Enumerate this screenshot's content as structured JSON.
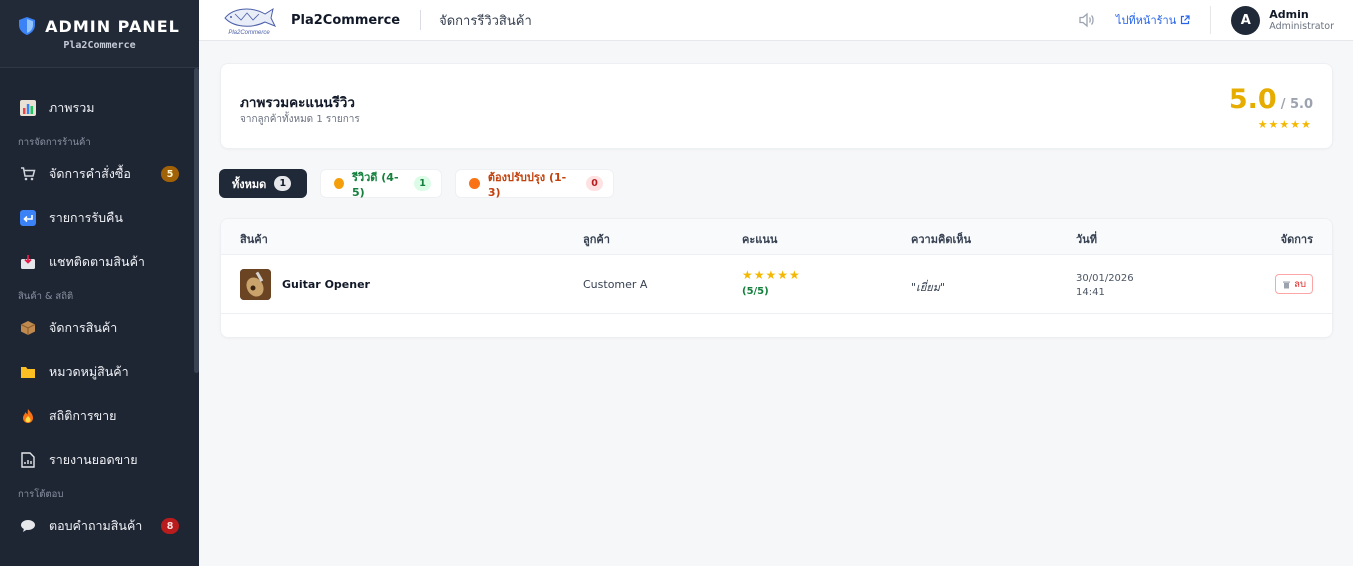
{
  "sidebar": {
    "title": "ADMIN PANEL",
    "subtitle": "Pla2Commerce",
    "items": [
      {
        "label": "ภาพรวม"
      },
      {
        "section": "การจัดการร้านค้า"
      },
      {
        "label": "จัดการคำสั่งซื้อ",
        "badge": "5"
      },
      {
        "label": "รายการรับคืน"
      },
      {
        "label": "แชทติดตามสินค้า"
      },
      {
        "section": "สินค้า & สถิติ"
      },
      {
        "label": "จัดการสินค้า"
      },
      {
        "label": "หมวดหมู่สินค้า"
      },
      {
        "label": "สถิติการขาย"
      },
      {
        "label": "รายงานยอดขาย"
      },
      {
        "section": "การโต้ตอบ"
      },
      {
        "label": "ตอบคำถามสินค้า",
        "badge": "8"
      }
    ]
  },
  "header": {
    "logo_text": "Pla2Commerce",
    "app_name": "Pla2Commerce",
    "page_title": "จัดการรีวิวสินค้า",
    "store_link": "ไปที่หน้าร้าน",
    "user": {
      "initial": "A",
      "name": "Admin",
      "role": "Administrator"
    }
  },
  "summary": {
    "title": "ภาพรวมคะแนนรีวิว",
    "subtitle": "จากลูกค้าทั้งหมด 1 รายการ",
    "score": "5.0",
    "max": "/ 5.0",
    "rating": 5
  },
  "tabs": [
    {
      "label": "ทั้งหมด",
      "count": "1"
    },
    {
      "label": "รีวิวดี (4-5)",
      "count": "1"
    },
    {
      "label": "ต้องปรับปรุง (1-3)",
      "count": "0"
    }
  ],
  "table": {
    "columns": [
      "สินค้า",
      "ลูกค้า",
      "คะแนน",
      "ความคิดเห็น",
      "วันที่",
      "จัดการ"
    ],
    "rows": [
      {
        "product": "Guitar Opener",
        "customer": "Customer A",
        "rating": 5,
        "rating_text": "(5/5)",
        "comment": "\"เยี่ยม\"",
        "date": "30/01/2026",
        "time": "14:41",
        "action": "ลบ"
      }
    ]
  },
  "colors": {
    "sidebar_bg": "#1e2533",
    "accent_gold": "#e6ac00",
    "star": "#f5b800",
    "link_blue": "#2563eb",
    "good_green": "#15803d",
    "bad_red": "#b91c1c"
  }
}
